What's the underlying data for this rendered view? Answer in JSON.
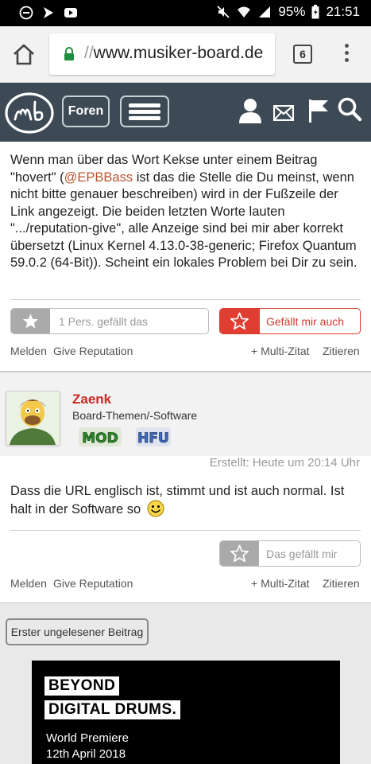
{
  "status_bar": {
    "battery": "95%",
    "time": "21:51"
  },
  "browser": {
    "url_scheme": "//",
    "url": "www.musiker-board.de",
    "tab_count": "6"
  },
  "header": {
    "forums_label": "Foren"
  },
  "post1": {
    "text_before": "Wenn man über das Wort Kekse unter einem Beitrag \"hovert\" (",
    "mention": "@EPBBass",
    "text_after": " ist das die Stelle die Du meinst, wenn nicht bitte genauer beschreiben) wird in der Fußzeile der Link angezeigt. Die beiden letzten Worte lauten \".../reputation-give\", alle Anzeige sind bei mir aber korrekt übersetzt (Linux Kernel 4.13.0-38-generic; Firefox Quantum 59.0.2 (64-Bit)). Scheint ein lokales Problem bei Dir zu sein.",
    "likes_label": "1 Pers. gefällt das",
    "like_me_label": "Gefällt mir auch",
    "actions": {
      "report": "Melden",
      "reputation": "Give Reputation",
      "multiquote": "+ Multi-Zitat",
      "quote": "Zitieren"
    }
  },
  "post2": {
    "author": "Zaenk",
    "author_title": "Board-Themen/-Software",
    "badges": [
      "MOD",
      "HFU"
    ],
    "created": "Erstellt: Heute um 20:14 Uhr",
    "text": "Dass die URL englisch ist, stimmt und ist auch normal. Ist halt in der Software so",
    "like_label": "Das gefällt mir",
    "actions": {
      "report": "Melden",
      "reputation": "Give Reputation",
      "multiquote": "+ Multi-Zitat",
      "quote": "Zitieren"
    }
  },
  "footer": {
    "unread_button": "Erster ungelesener Beitrag",
    "ad_lines": [
      "BEYOND",
      "DIGITAL DRUMS.",
      "World Premiere",
      "12th April 2018"
    ]
  },
  "colors": {
    "header_bg": "#3d4a55",
    "accent_red": "#e03e32",
    "username_red": "#c62a22",
    "mention": "#b85431"
  }
}
